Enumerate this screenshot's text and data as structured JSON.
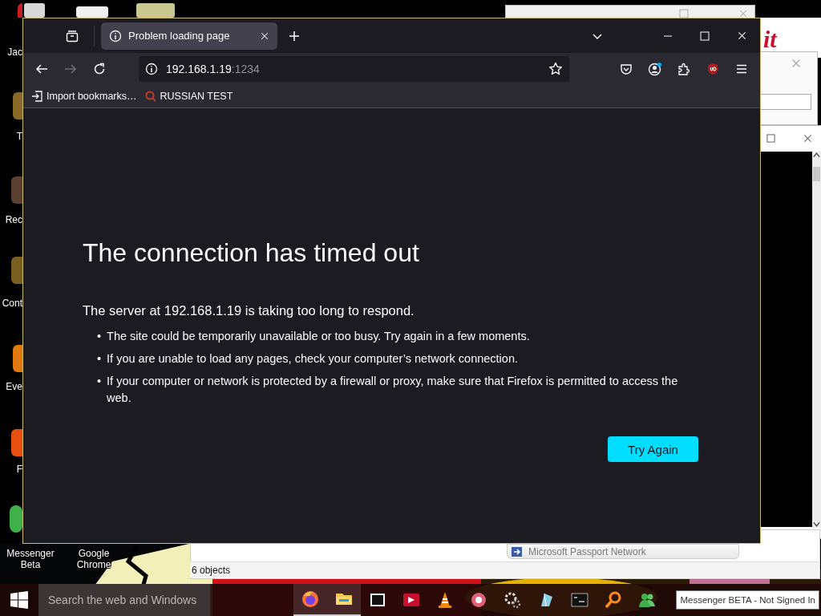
{
  "desktop_icons": [
    {
      "label": "Jac"
    },
    {
      "label": "T"
    },
    {
      "label": "Rec"
    },
    {
      "label": "Cont"
    },
    {
      "label": "Eve"
    },
    {
      "label": "F"
    },
    {
      "label": "Messenger Beta"
    },
    {
      "label": "Google Chrome"
    }
  ],
  "background_windows": {
    "logo_fragment": "it",
    "explorer_item": "Microsoft Passport Network",
    "explorer_status": "6 objects"
  },
  "browser": {
    "tabs": [
      {
        "title": "Problem loading page",
        "selected": true
      }
    ],
    "address": {
      "host": "192.168.1.19",
      "port": ":1234"
    },
    "bookmarks": [
      {
        "label": "Import bookmarks…",
        "kind": "import"
      },
      {
        "label": "RUSSIAN TEST",
        "kind": "site"
      }
    ],
    "error": {
      "title": "The connection has timed out",
      "message": "The server at 192.168.1.19 is taking too long to respond.",
      "tips": [
        {
          "bullet": "•",
          "text": "The site could be temporarily unavailable or too busy. Try again in a few moments."
        },
        {
          "bullet": "•",
          "text": "If you are unable to load any pages, check your computer’s network connection."
        },
        {
          "bullet": "•",
          "text": "If your computer or network is protected by a firewall or proxy, make sure that Firefox is permitted to access the web."
        }
      ],
      "button": "Try Again"
    }
  },
  "taskbar": {
    "search": {
      "placeholder": "Search the web and Windows"
    },
    "tooltip": "Messenger BETA - Not Signed In"
  }
}
